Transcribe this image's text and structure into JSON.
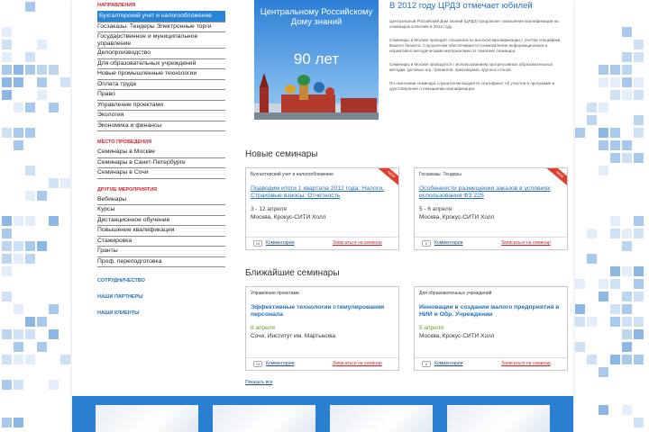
{
  "colors": {
    "accent": "#2a86d4",
    "red": "#d2232a",
    "link": "#1f6fbf"
  },
  "sidebar": {
    "sections": [
      {
        "heading": "НАПРАВЛЕНИЯ",
        "items": [
          "Бухгалтерский учет и налогообложение",
          "Госзаказы. Тендеры Электронные торги",
          "Государственное и муниципальное управление",
          "Делопроизводство",
          "Для образовательных учреждений",
          "Новые промышленные технологии",
          "Оплата труда",
          "Право",
          "Управление проектами",
          "Экология",
          "Экономика и финансы"
        ]
      },
      {
        "heading": "МЕСТО ПРОВЕДЕНИЯ",
        "items": [
          "Семинары в Москве",
          "Семинары в Санкт-Петербурге",
          "Семинары в Сочи"
        ]
      },
      {
        "heading": "ДРУГИЕ МЕРОПРИЯТИЯ",
        "items": [
          "Вебинары",
          "Курсы",
          "Дистанционное обучение",
          "Повышение квалификации",
          "Стажировка",
          "Гранты",
          "Проф. переподготовка"
        ]
      }
    ],
    "links": [
      "СОТРУДНИЧЕСТВО",
      "НАШИ ПАРТНЕРЫ",
      "НАШИ КЛИЕНТЫ"
    ]
  },
  "hero": {
    "text": "Центральному Российскому Дому знаний",
    "years": "90 лет"
  },
  "intro": {
    "title": "В 2012 году ЦРДЗ отмечает юбилей",
    "p1": "Центральный Российский Дом знаний (ЦРДЗ) предлагает повышение квалификации на семинарах в Москве в 2012 году.",
    "p2": "Семинары в Москве проводят специалисты высокой квалификации с учетом специфики Вашего бизнеса. Слушателям обеспечивается ознакомление информационным и нормативно-методическими материалами по тематике семинара.",
    "p3": "Семинары в Москве проводятся с использованием прогрессивных образовательных методик: деловых игр, тренингов, практикумов, круглых столов.",
    "p4": "По окончании семинара слушателям выдается сертификат об участии в программе и удостоверение о повышении квалификации."
  },
  "new_seminars": {
    "title": "Новые семинары",
    "cards": [
      {
        "category": "Бухгалтерский учет и налогообложение",
        "title": "Подводим итоги 1 квартала 2012 года: Налоги. Страховые взносы. Отчетность",
        "date": "3 - 12 апреля",
        "place": "Москва, Крокус-СИТИ Холл",
        "count": "25",
        "comments": "Комментарии",
        "signup": "Записаться на семинар",
        "ribbon": "NEW"
      },
      {
        "category": "Госзаказы. Тендеры",
        "title": "Особенности размещения заказов в условиях использования ФЗ 225",
        "date": "5 - 6 апреля",
        "place": "Москва, Крокус-СИТИ Холл",
        "count": "6",
        "comments": "Комментарии",
        "signup": "Записаться на семинар",
        "ribbon": "NEW"
      }
    ]
  },
  "upcoming": {
    "title": "Ближайшие семинары",
    "cards": [
      {
        "category": "Управление проектами",
        "title": "Эффективные технологии стимулирования персонала",
        "date": "8 апреля",
        "place": "Сочи, Институт им. Мартынова",
        "count": "23",
        "comments": "Комментарии",
        "signup": "Записаться на семинар"
      },
      {
        "category": "Для образовательных учреждений",
        "title": "Инновации в создании малого предприятия в НИИ и Обр. Учреждении",
        "date": "5 апреля",
        "place": "Москва, Крокус-СИТИ Холл",
        "count": "6",
        "comments": "Комментарии",
        "signup": "Записаться на семинар"
      }
    ]
  },
  "show_all": "Показать все"
}
